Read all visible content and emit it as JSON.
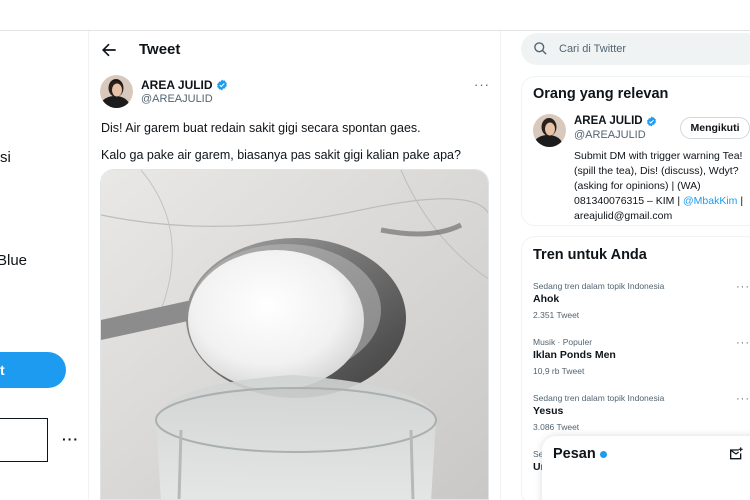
{
  "sidebar": {
    "nav_fragments": [
      "si",
      "Blue"
    ],
    "post_label": "t",
    "more_label": "···"
  },
  "header": {
    "title": "Tweet",
    "back_icon": "arrow-left-icon"
  },
  "tweet": {
    "author_name": "AREA JULID",
    "author_handle": "@AREAJULID",
    "verified": true,
    "more_label": "···",
    "lines": [
      "Dis! Air garem buat redain sakit gigi secara spontan gaes.",
      "Kalo ga pake air garem, biasanya pas sakit gigi kalian pake apa?"
    ]
  },
  "search": {
    "placeholder": "Cari di Twitter",
    "icon": "search-icon"
  },
  "relevant": {
    "title": "Orang yang relevan",
    "name": "AREA JULID",
    "handle": "@AREAJULID",
    "follow_label": "Mengikuti",
    "bio_lines": [
      "Submit DM with trigger warning Tea!",
      "(spill the tea), Dis! (discuss), Wdyt?",
      "(asking for opinions) | (WA)"
    ],
    "bio_line4_text": "081340076315 – KIM | ",
    "bio_line4_link": "@MbakKim",
    "bio_line4_tail": " |",
    "bio_line5": "areajulid@gmail.com"
  },
  "trends": {
    "title": "Tren untuk Anda",
    "items": [
      {
        "meta": "Sedang tren dalam topik Indonesia",
        "name": "Ahok",
        "count": "2.351 Tweet"
      },
      {
        "meta": "Musik · Populer",
        "name": "Iklan Ponds Men",
        "count": "10,9 rb Tweet"
      },
      {
        "meta": "Sedang tren dalam topik Indonesia",
        "name": "Yesus",
        "count": "3.086 Tweet"
      },
      {
        "meta": "Se",
        "name": "Ur",
        "count": ""
      }
    ],
    "more_label": "···"
  },
  "messages": {
    "title": "Pesan",
    "icon": "new-message-icon"
  },
  "colors": {
    "accent": "#1d9bf0",
    "text": "#0f1419",
    "muted": "#536471"
  }
}
